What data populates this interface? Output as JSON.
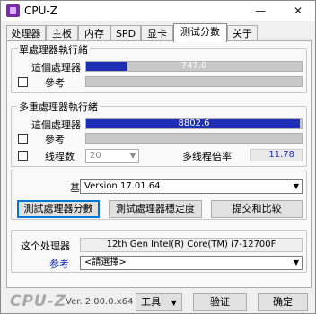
{
  "window": {
    "title": "CPU-Z",
    "minimize": "—",
    "close": "✕"
  },
  "tabs": [
    {
      "label": "处理器"
    },
    {
      "label": "主板"
    },
    {
      "label": "内存"
    },
    {
      "label": "SPD"
    },
    {
      "label": "显卡"
    },
    {
      "label": "测试分数"
    },
    {
      "label": "关于"
    }
  ],
  "single_thread": {
    "legend": "單處理器執行緒",
    "this_cpu_label": "這個處理器",
    "this_cpu_value": "747.0",
    "this_cpu_fraction": 0.19,
    "reference_label": "參考"
  },
  "multi_thread": {
    "legend": "多重處理器執行緒",
    "this_cpu_label": "這個處理器",
    "this_cpu_value": "8802.6",
    "this_cpu_fraction": 0.99,
    "reference_label": "參考",
    "threads_label": "线程数",
    "threads_value": "20",
    "ratio_label": "多线程倍率",
    "ratio_value": "11.78"
  },
  "benchmark": {
    "label": "基准",
    "selected_version": "Version 17.01.64",
    "bench_button": "測試處理器分數",
    "stress_button": "測試處理器穩定度",
    "submit_button": "提交和比较"
  },
  "processor": {
    "label": "这个处理器",
    "name": "12th Gen Intel(R) Core(TM) i7-12700F",
    "reference_label": "参考",
    "reference_placeholder": "<請選擇>"
  },
  "footer": {
    "brand": "CPU-Z",
    "version": "Ver. 2.00.0.x64",
    "tools_button": "工具",
    "validate_button": "验证",
    "ok_button": "确定"
  },
  "colors": {
    "bar_fill": "#1f2fb5",
    "bar_track": "#c8c8c8",
    "accent": "#1a2fb0"
  }
}
